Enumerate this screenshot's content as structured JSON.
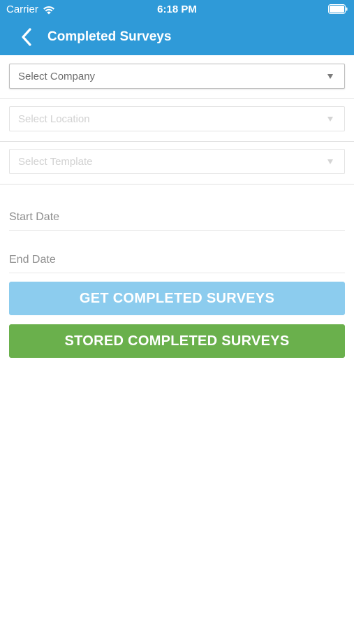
{
  "status_bar": {
    "carrier": "Carrier",
    "time": "6:18 PM"
  },
  "nav": {
    "title": "Completed Surveys",
    "back_icon": "chevron-left-icon"
  },
  "filters": {
    "company_placeholder": "Select Company",
    "location_placeholder": "Select Location",
    "template_placeholder": "Select Template"
  },
  "dates": {
    "start_label": "Start Date",
    "end_label": "End Date"
  },
  "buttons": {
    "get_label": "GET COMPLETED SURVEYS",
    "stored_label": "STORED COMPLETED SURVEYS"
  },
  "colors": {
    "header": "#2f9ad8",
    "get_button": "#8cccee",
    "stored_button": "#6ab04c"
  }
}
